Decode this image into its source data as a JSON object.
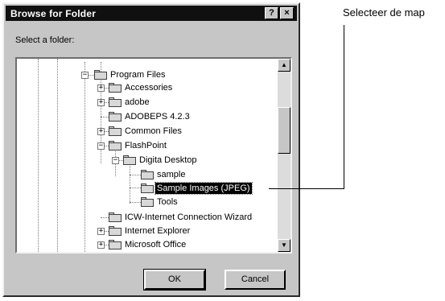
{
  "dialog": {
    "title": "Browse for Folder",
    "help_btn": "?",
    "close_btn": "×",
    "prompt": "Select a folder:",
    "ok_label": "OK",
    "cancel_label": "Cancel"
  },
  "tree": {
    "items": [
      {
        "label": "Program Files",
        "expander": "−"
      },
      {
        "label": "Accessories",
        "expander": "+"
      },
      {
        "label": "adobe",
        "expander": "+"
      },
      {
        "label": "ADOBEPS 4.2.3",
        "expander": ""
      },
      {
        "label": "Common Files",
        "expander": "+"
      },
      {
        "label": "FlashPoint",
        "expander": "−"
      },
      {
        "label": "Digita Desktop",
        "expander": "−"
      },
      {
        "label": "sample",
        "expander": ""
      },
      {
        "label": "Sample Images (JPEG)",
        "expander": "",
        "selected": true
      },
      {
        "label": "Tools",
        "expander": ""
      },
      {
        "label": "ICW-Internet Connection Wizard",
        "expander": ""
      },
      {
        "label": "Internet Explorer",
        "expander": "+"
      },
      {
        "label": "Microsoft Office",
        "expander": "+"
      }
    ]
  },
  "scrollbar": {
    "up_arrow": "▲",
    "down_arrow": "▼"
  },
  "callout": {
    "text": "Selecteer de map"
  }
}
